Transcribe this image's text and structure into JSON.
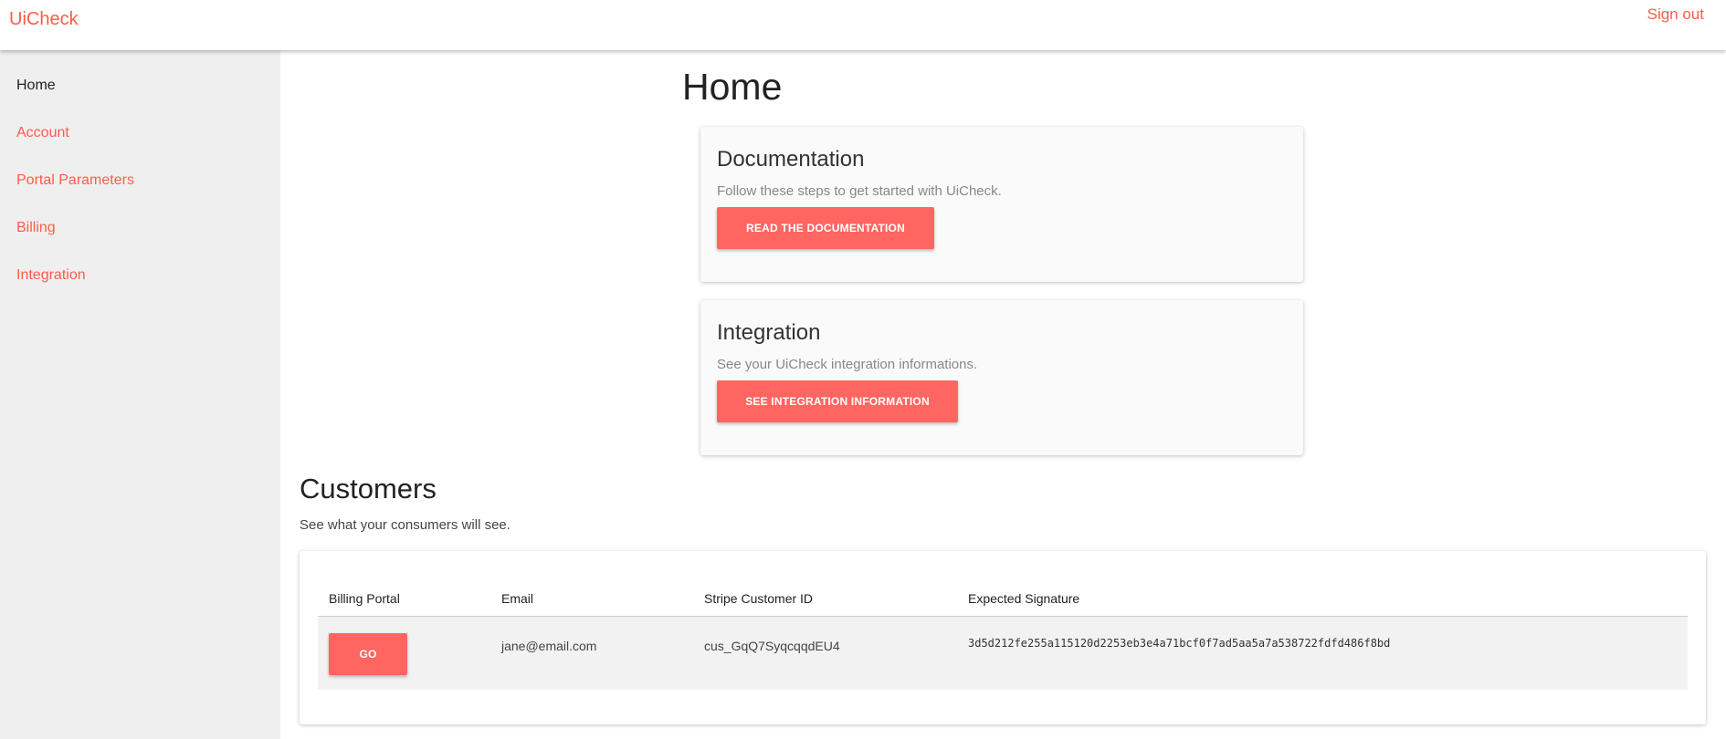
{
  "header": {
    "brand": "UiCheck",
    "signout_label": "Sign out"
  },
  "sidebar": {
    "items": [
      {
        "label": "Home"
      },
      {
        "label": "Account"
      },
      {
        "label": "Portal Parameters"
      },
      {
        "label": "Billing"
      },
      {
        "label": "Integration"
      }
    ]
  },
  "main": {
    "title": "Home",
    "cards": [
      {
        "title": "Documentation",
        "description": "Follow these steps to get started with UiCheck.",
        "button_label": "READ THE DOCUMENTATION"
      },
      {
        "title": "Integration",
        "description": "See your UiCheck integration informations.",
        "button_label": "SEE INTEGRATION INFORMATION"
      }
    ],
    "customers": {
      "title": "Customers",
      "description": "See what your consumers will see.",
      "columns": [
        "Billing Portal",
        "Email",
        "Stripe Customer ID",
        "Expected Signature"
      ],
      "rows": [
        {
          "button_label": "GO",
          "email": "jane@email.com",
          "stripe_id": "cus_GqQ7SyqcqqdEU4",
          "signature": "3d5d212fe255a115120d2253eb3e4a71bcf0f7ad5aa5a7a538722fdfd486f8bd"
        }
      ]
    }
  },
  "colors": {
    "accent": "#ff5c49",
    "button": "#ff6561",
    "sidebar_bg": "#efefef"
  }
}
